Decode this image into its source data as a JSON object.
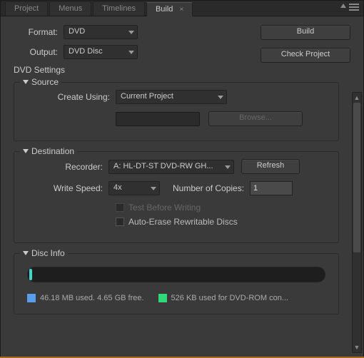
{
  "tabs": {
    "project": "Project",
    "menus": "Menus",
    "timelines": "Timelines",
    "build": "Build"
  },
  "top": {
    "format_label": "Format:",
    "format_value": "DVD",
    "output_label": "Output:",
    "output_value": "DVD Disc",
    "build_btn": "Build",
    "check_btn": "Check Project"
  },
  "settings_title": "DVD Settings",
  "source": {
    "header": "Source",
    "create_using_label": "Create Using:",
    "create_using_value": "Current Project",
    "browse_btn": "Browse..."
  },
  "destination": {
    "header": "Destination",
    "recorder_label": "Recorder:",
    "recorder_value": "A: HL-DT-ST DVD-RW GH...",
    "refresh_btn": "Refresh",
    "write_speed_label": "Write Speed:",
    "write_speed_value": "4x",
    "copies_label": "Number of Copies:",
    "copies_value": "1",
    "test_label": "Test Before Writing",
    "autoerase_label": "Auto-Erase Rewritable Discs"
  },
  "disc_info": {
    "header": "Disc Info",
    "used_text": "46.18 MB used.  4.65 GB free.",
    "rom_text": "526 KB used for DVD-ROM con...",
    "colors": {
      "used": "#5a9de8",
      "rom": "#2fd97a"
    }
  }
}
